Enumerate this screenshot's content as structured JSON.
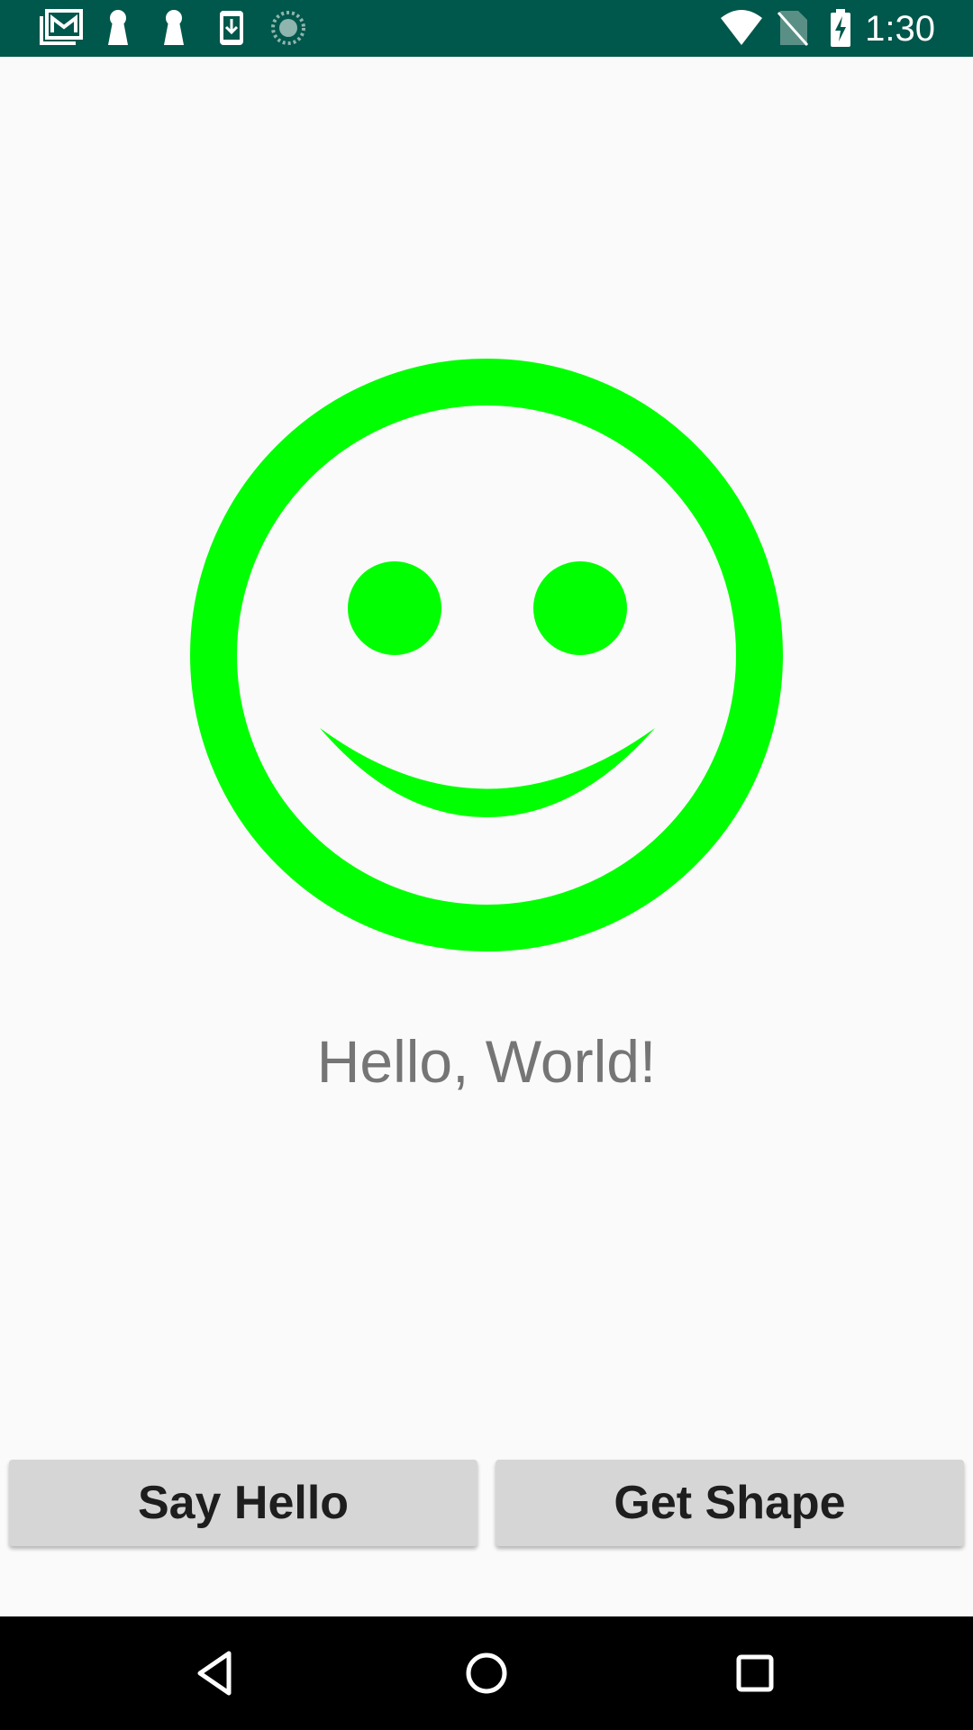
{
  "status_bar": {
    "time": "1:30",
    "background": "#00574b",
    "left_icons": [
      "gmail-icon",
      "keyhole-icon",
      "keyhole-icon",
      "download-icon",
      "sync-icon"
    ],
    "right_icons": [
      "wifi-icon",
      "no-sim-icon",
      "battery-charging-icon"
    ]
  },
  "main": {
    "image": {
      "icon": "smiley-face-icon",
      "color": "#00ff00"
    },
    "greeting": "Hello, World!"
  },
  "buttons": {
    "say_hello": "Say Hello",
    "get_shape": "Get Shape"
  },
  "nav_bar": {
    "items": [
      "back-icon",
      "home-icon",
      "recents-icon"
    ]
  }
}
